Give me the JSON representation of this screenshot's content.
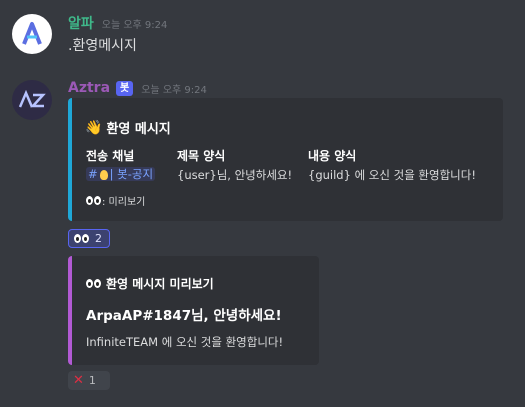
{
  "msg1": {
    "username": "알파",
    "timestamp": "오늘 오후 9:24",
    "text": ".환영메시지"
  },
  "msg2": {
    "username": "Aztra",
    "bot_tag": "봇",
    "timestamp": "오늘 오후 9:24",
    "embed": {
      "title": "환영 메시지",
      "fields": [
        {
          "name": "전송 채널",
          "value": "#💡 | 봇-공지"
        },
        {
          "name": "제목 양식",
          "value": "{user}님, 안녕하세요!"
        },
        {
          "name": "내용 양식",
          "value": "{guild} 에 오신 것을 환영합니다!"
        }
      ],
      "footer": ": 미리보기",
      "channel_hash": "#",
      "channel_name": "| 봇-공지"
    },
    "reaction1": {
      "emoji": "eyes",
      "count": "2"
    },
    "embed2": {
      "title": "환영 메시지 미리보기",
      "heading": "ArpaAP#1847님, 안녕하세요!",
      "description": "InfiniteTEAM 에 오신 것을 환영합니다!"
    },
    "reaction2": {
      "emoji": "x",
      "count": "1"
    }
  },
  "colors": {
    "background": "#36393f",
    "embed_bg": "#2f3136",
    "embed1_accent": "#1fa8d8",
    "embed2_accent": "#b25ad4",
    "user1": "#3fb88a",
    "user2": "#9b59b6"
  }
}
